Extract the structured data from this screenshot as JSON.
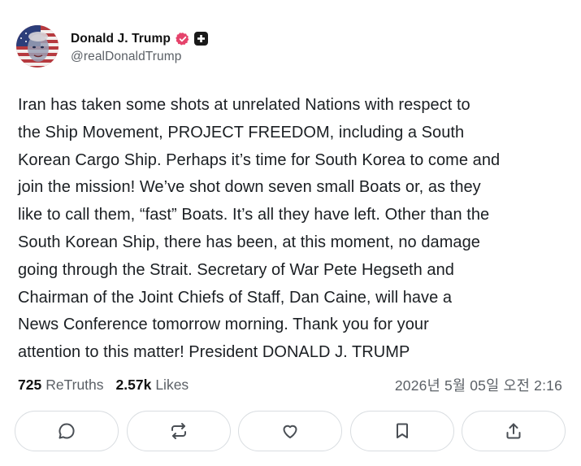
{
  "author": {
    "display_name": "Donald J. Trump",
    "handle": "@realDonaldTrump",
    "avatar_icon": "avatar-flag-portrait",
    "verified_color": "#e5436b"
  },
  "post": {
    "text": "Iran has taken some shots at unrelated Nations with respect to\nthe Ship Movement, PROJECT FREEDOM, including a South\nKorean Cargo Ship. Perhaps it’s time for South Korea to come and\njoin the mission! We’ve shot down seven small Boats or, as they\nlike to call them, “fast” Boats. It’s all they have left. Other than the\nSouth Korean Ship, there has been, at this moment, no damage\ngoing through the Strait. Secretary of War Pete Hegseth and\nChairman of the Joint Chiefs of Staff, Dan Caine, will have a\nNews Conference tomorrow morning. Thank you for your\nattention to this matter! President DONALD J. TRUMP"
  },
  "stats": {
    "retruths_count": "725",
    "retruths_label": "ReTruths",
    "likes_count": "2.57k",
    "likes_label": "Likes",
    "timestamp": "2026년 5월 05일 오전 2:16"
  },
  "actions": [
    {
      "icon": "reply-icon"
    },
    {
      "icon": "retruth-icon"
    },
    {
      "icon": "like-icon"
    },
    {
      "icon": "bookmark-icon"
    },
    {
      "icon": "share-icon"
    }
  ],
  "colors": {
    "text": "#1b1f23",
    "muted": "#5b6066",
    "border": "#d9dde1",
    "icon": "#4a4f55"
  }
}
